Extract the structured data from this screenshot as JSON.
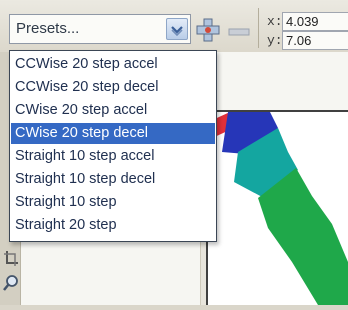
{
  "toolbar": {
    "presets_label": "Presets...",
    "x_label": "x:",
    "x_value": "4.039",
    "y_label": "y:",
    "y_value": "7.06"
  },
  "presets_list": {
    "items": [
      "CCWise 20 step accel",
      "CCWise 20 step decel",
      "CWise 20 step accel",
      "CWise 20 step decel",
      "Straight 10 step accel",
      "Straight 10 step decel",
      "Straight 10 step",
      "Straight 20 step"
    ],
    "selected": "CWise 20 step decel"
  },
  "colors": {
    "selection": "#3569c4",
    "blend_red": "#e0303a",
    "blend_blue": "#2636b8",
    "blend_teal": "#14a6a0",
    "blend_green": "#1fa84a"
  },
  "icons": [
    "chevron-down-icon",
    "add-preset-icon",
    "remove-preset-icon",
    "zoom-icon"
  ]
}
